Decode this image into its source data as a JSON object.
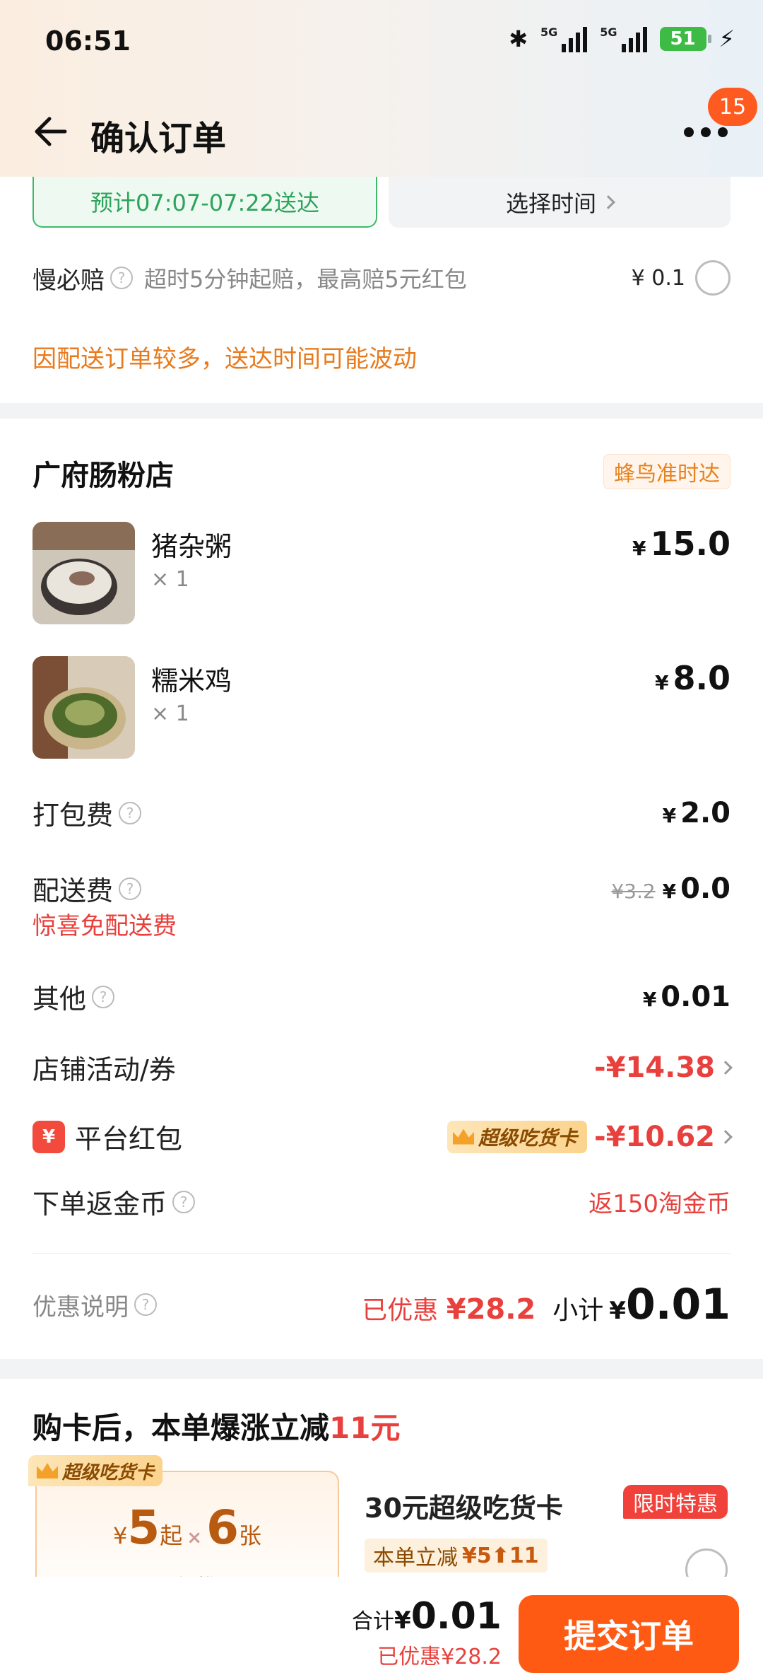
{
  "status": {
    "time": "06:51",
    "battery": "51",
    "net1": "5G",
    "net2": "5G"
  },
  "header": {
    "title": "确认订单",
    "badge": "15"
  },
  "delivery": {
    "estimate": "预计07:07-07:22送达",
    "choose_time": "选择时间",
    "guarantee_label": "慢必赔",
    "guarantee_desc": "超时5分钟起赔，最高赔5元红包",
    "guarantee_price": "¥ 0.1",
    "notice": "因配送订单较多，送达时间可能波动"
  },
  "shop": {
    "name": "广府肠粉店",
    "tag": "蜂鸟准时达",
    "items": [
      {
        "name": "猪杂粥",
        "qty": "× 1",
        "price": "15.0"
      },
      {
        "name": "糯米鸡",
        "qty": "× 1",
        "price": "8.0"
      }
    ],
    "fees": {
      "packing_label": "打包费",
      "packing_value": "2.0",
      "delivery_label": "配送费",
      "delivery_original": "¥3.2",
      "delivery_value": "0.0",
      "delivery_note": "惊喜免配送费",
      "other_label": "其他",
      "other_value": "0.01",
      "shop_promo_label": "店铺活动/券",
      "shop_promo_value": "-¥14.38",
      "platform_label": "平台红包",
      "platform_badge": "超级吃货卡",
      "platform_value": "-¥10.62",
      "coins_label": "下单返金币",
      "coins_value": "返150淘金币"
    },
    "summary": {
      "disc_label": "优惠说明",
      "saved_prefix": "已优惠 ",
      "saved_value": "¥28.2",
      "subtotal_label": "小计",
      "subtotal_value": "0.01"
    }
  },
  "promo": {
    "title_prefix": "购卡后，本单爆涨立减",
    "title_amount": "11元",
    "coupon_tag": "超级吃货卡",
    "coupon_price": "5",
    "coupon_from": "起",
    "coupon_count": "6",
    "coupon_unit": "张",
    "coupon_sub": "无门槛",
    "card_name": "30元超级吃货卡",
    "limit_tag": "限时特惠",
    "reduce_label": "本单立减",
    "reduce_value": "¥5⬆11"
  },
  "bottom": {
    "total_label": "合计",
    "total_value": "0.01",
    "saved": "已优惠¥28.2",
    "submit": "提交订单"
  }
}
